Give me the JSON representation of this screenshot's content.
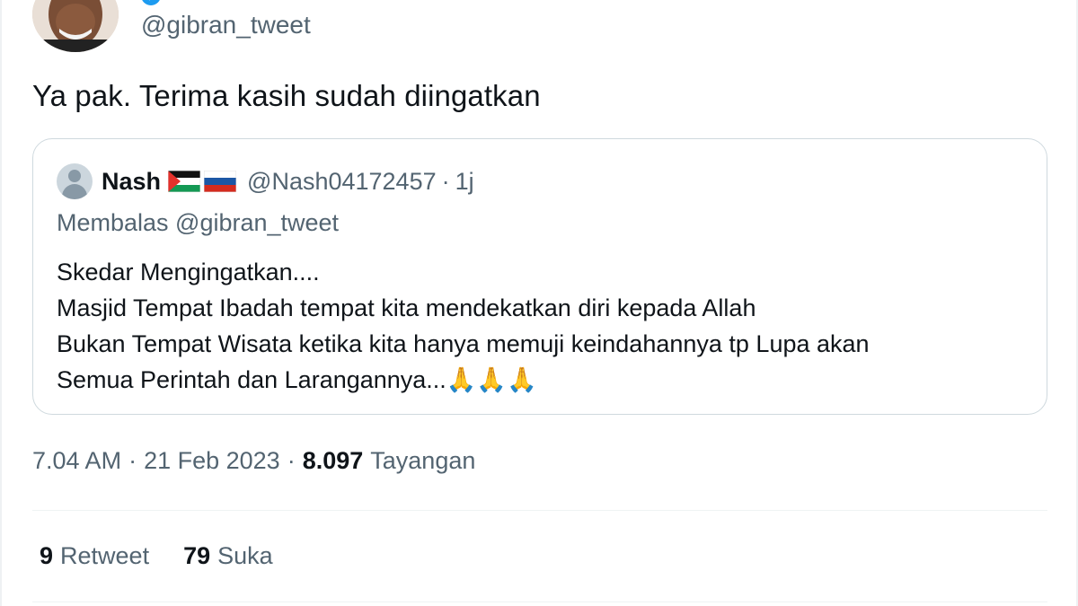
{
  "author": {
    "handle": "@gibran_tweet",
    "avatar_icon": "person-photo",
    "verified_icon": "verified-badge-icon",
    "accent": "#1d9bf0"
  },
  "tweet": {
    "text": "Ya pak. Terima kasih sudah diingatkan"
  },
  "quoted": {
    "name": "Nash",
    "flags": [
      "palestine-flag-icon",
      "russia-flag-icon"
    ],
    "handle": "@Nash04172457",
    "separator": "·",
    "time": "1j",
    "replying_to": "Membalas @gibran_tweet",
    "lines": [
      "Skedar Mengingatkan....",
      "Masjid Tempat Ibadah tempat kita mendekatkan diri kepada Allah",
      "Bukan Tempat Wisata ketika kita hanya memuji keindahannya tp Lupa akan",
      "Semua Perintah dan Larangannya...🙏🙏🙏"
    ]
  },
  "meta": {
    "time": "7.04 AM",
    "sep1": "·",
    "date": "21 Feb 2023",
    "sep2": "·",
    "views_count": "8.097",
    "views_label": "Tayangan"
  },
  "stats": {
    "retweets_count": "9",
    "retweets_label": "Retweet",
    "likes_count": "79",
    "likes_label": "Suka"
  },
  "colors": {
    "text_primary": "#0f1419",
    "text_secondary": "#536471",
    "border": "#cfd9de"
  }
}
